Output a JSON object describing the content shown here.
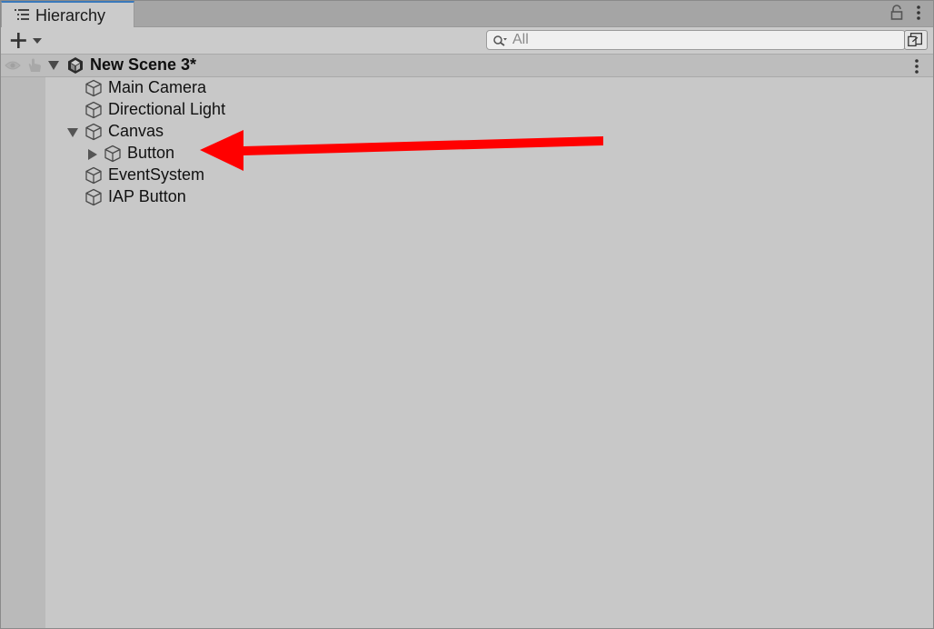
{
  "window": {
    "tab_label": "Hierarchy",
    "tab_icon": "hierarchy-list-icon",
    "lock_icon": "lock-icon",
    "menu_icon": "kebab-menu-icon"
  },
  "toolbar": {
    "add_icon": "plus-dropdown-icon",
    "search": {
      "placeholder": "All",
      "value": "",
      "icon": "search-icon"
    },
    "search_mode_icon": "search-mode-icon"
  },
  "scene": {
    "name": "New Scene 3*",
    "expanded": true,
    "icon": "unity-scene-icon",
    "visibility_icon": "eye-icon",
    "pickability_icon": "hand-pointer-icon",
    "menu_icon": "kebab-menu-icon"
  },
  "hierarchy": [
    {
      "label": "Main Camera",
      "depth": 1,
      "expandable": false
    },
    {
      "label": "Directional Light",
      "depth": 1,
      "expandable": false
    },
    {
      "label": "Canvas",
      "depth": 1,
      "expandable": true,
      "expanded": true
    },
    {
      "label": "Button",
      "depth": 2,
      "expandable": true,
      "expanded": false
    },
    {
      "label": "EventSystem",
      "depth": 1,
      "expandable": false
    },
    {
      "label": "IAP Button",
      "depth": 1,
      "expandable": false
    }
  ],
  "annotation": {
    "type": "arrow",
    "color": "#ff0000",
    "points_to": "Button"
  },
  "colors": {
    "panel_bg": "#c8c8c8",
    "tabbar_bg": "#a5a5a5",
    "gutter_bg": "#bababa",
    "accent": "#3a79bb"
  }
}
